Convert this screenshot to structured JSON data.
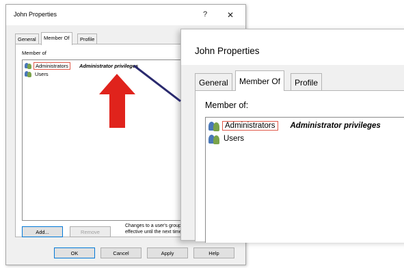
{
  "dialog": {
    "title": "John Properties",
    "help_glyph": "?",
    "close_glyph": "✕",
    "tabs": [
      {
        "label": "General"
      },
      {
        "label": "Member Of"
      },
      {
        "label": "Profile"
      }
    ],
    "member_of_label": "Member of",
    "members": [
      {
        "name": "Administrators",
        "description": "Administrator privileges",
        "icon": "group-icon"
      },
      {
        "name": "Users",
        "description": "",
        "icon": "group-icon"
      }
    ],
    "add_label": "Add...",
    "remove_label": "Remove",
    "note": "Changes to a user's group membership are not effective until the next time the user logs on.",
    "ok_label": "OK",
    "cancel_label": "Cancel",
    "apply_label": "Apply",
    "help_label": "Help"
  },
  "zoom": {
    "title": "John Properties",
    "tabs": [
      {
        "label": "General"
      },
      {
        "label": "Member Of"
      },
      {
        "label": "Profile"
      }
    ],
    "member_of_label": "Member of:",
    "members": [
      {
        "name": "Administrators",
        "description": "Administrator privileges",
        "icon": "group-icon"
      },
      {
        "name": "Users",
        "description": "",
        "icon": "group-icon"
      }
    ]
  },
  "annotations": {
    "arrow_color": "#e0231c",
    "pointer_line_color": "#2a2a6e"
  }
}
